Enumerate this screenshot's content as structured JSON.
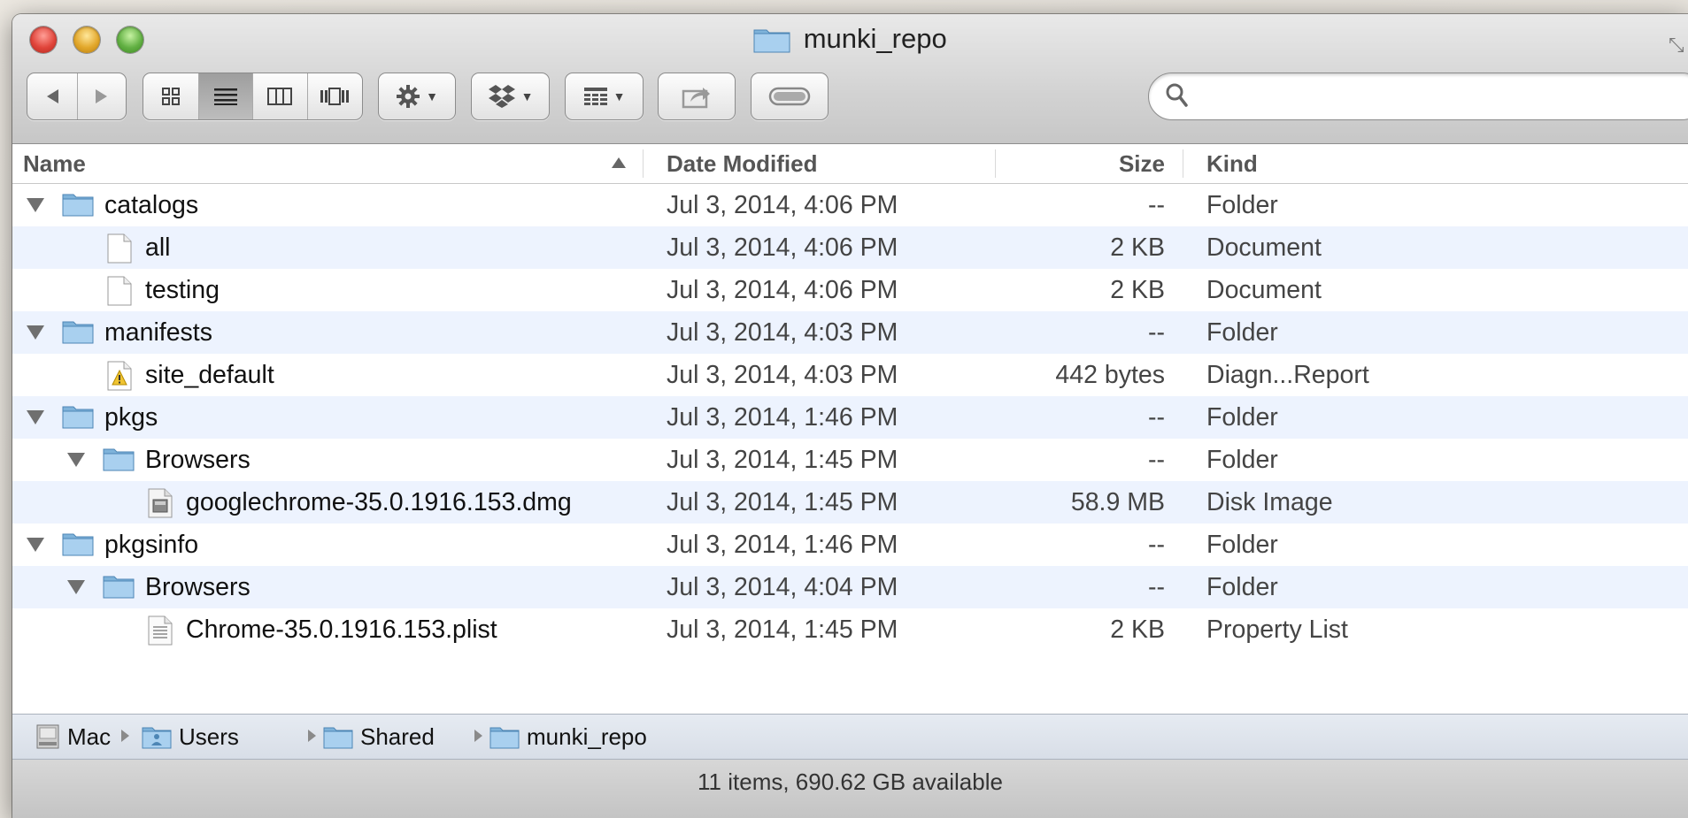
{
  "window": {
    "title": "munki_repo"
  },
  "search": {
    "placeholder": ""
  },
  "columns": {
    "name": "Name",
    "date": "Date Modified",
    "size": "Size",
    "kind": "Kind"
  },
  "rows": [
    {
      "name": "catalogs",
      "date": "Jul 3, 2014, 4:06 PM",
      "size": "--",
      "kind": "Folder",
      "icon": "folder-icon",
      "level": 0,
      "expanded": true
    },
    {
      "name": "all",
      "date": "Jul 3, 2014, 4:06 PM",
      "size": "2 KB",
      "kind": "Document",
      "icon": "document-icon",
      "level": 1
    },
    {
      "name": "testing",
      "date": "Jul 3, 2014, 4:06 PM",
      "size": "2 KB",
      "kind": "Document",
      "icon": "document-icon",
      "level": 1
    },
    {
      "name": "manifests",
      "date": "Jul 3, 2014, 4:03 PM",
      "size": "--",
      "kind": "Folder",
      "icon": "folder-icon",
      "level": 0,
      "expanded": true
    },
    {
      "name": "site_default",
      "date": "Jul 3, 2014, 4:03 PM",
      "size": "442 bytes",
      "kind": "Diagn...Report",
      "icon": "diagnostic-report-icon",
      "level": 1
    },
    {
      "name": "pkgs",
      "date": "Jul 3, 2014, 1:46 PM",
      "size": "--",
      "kind": "Folder",
      "icon": "folder-icon",
      "level": 0,
      "expanded": true
    },
    {
      "name": "Browsers",
      "date": "Jul 3, 2014, 1:45 PM",
      "size": "--",
      "kind": "Folder",
      "icon": "folder-icon",
      "level": 1,
      "expanded": true
    },
    {
      "name": "googlechrome-35.0.1916.153.dmg",
      "date": "Jul 3, 2014, 1:45 PM",
      "size": "58.9 MB",
      "kind": "Disk Image",
      "icon": "disk-image-icon",
      "level": 2
    },
    {
      "name": "pkgsinfo",
      "date": "Jul 3, 2014, 1:46 PM",
      "size": "--",
      "kind": "Folder",
      "icon": "folder-icon",
      "level": 0,
      "expanded": true
    },
    {
      "name": "Browsers",
      "date": "Jul 3, 2014, 4:04 PM",
      "size": "--",
      "kind": "Folder",
      "icon": "folder-icon",
      "level": 1,
      "expanded": true
    },
    {
      "name": "Chrome-35.0.1916.153.plist",
      "date": "Jul 3, 2014, 1:45 PM",
      "size": "2 KB",
      "kind": "Property List",
      "icon": "plist-icon",
      "level": 2
    }
  ],
  "path": [
    {
      "label": "Mac",
      "icon": "hard-drive-icon"
    },
    {
      "label": "Users",
      "icon": "users-folder-icon"
    },
    {
      "label": "Shared",
      "icon": "folder-icon"
    },
    {
      "label": "munki_repo",
      "icon": "folder-icon"
    }
  ],
  "status": {
    "text": "11 items, 690.62 GB available"
  }
}
